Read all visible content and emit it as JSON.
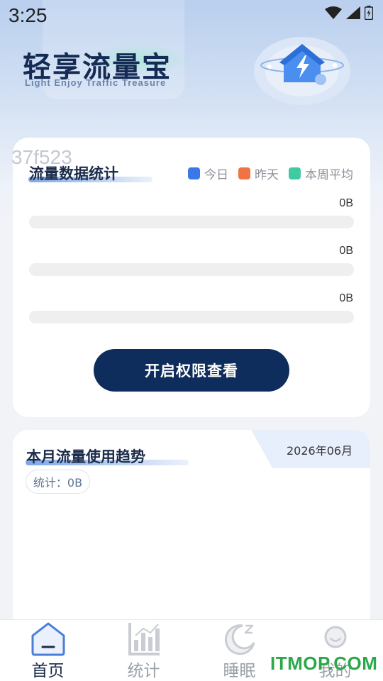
{
  "status_bar": {
    "time": "3:25"
  },
  "header": {
    "app_title_part1": "轻享",
    "app_title_part2": "流量宝",
    "app_subtitle": "Light Enjoy Traffic Treasure"
  },
  "watermark_code": "37f523",
  "stats_card": {
    "title": "流量数据统计",
    "legend": [
      {
        "label": "今日",
        "color": "#3b78e7"
      },
      {
        "label": "昨天",
        "color": "#f07343"
      },
      {
        "label": "本周平均",
        "color": "#3fcaa4"
      }
    ],
    "bars": [
      {
        "value_label": "0B",
        "value": 0,
        "color": "#3b78e7"
      },
      {
        "value_label": "0B",
        "value": 0,
        "color": "#f07343"
      },
      {
        "value_label": "0B",
        "value": 0,
        "color": "#3fcaa4"
      }
    ],
    "button_label": "开启权限查看"
  },
  "trend_card": {
    "title": "本月流量使用趋势",
    "date": "2026年06月",
    "stat_label": "统计：0B"
  },
  "bottom_nav": [
    {
      "label": "首页",
      "icon": "home-icon",
      "active": true
    },
    {
      "label": "统计",
      "icon": "bar-chart-icon",
      "active": false
    },
    {
      "label": "睡眠",
      "icon": "moon-sleep-icon",
      "active": false
    },
    {
      "label": "我的",
      "icon": "profile-icon",
      "active": false
    }
  ],
  "site_watermark": "ITMOP.COM",
  "colors": {
    "primary": "#0f2d5c",
    "accent_blue": "#3b78e7",
    "accent_orange": "#f07343",
    "accent_green": "#3fcaa4"
  }
}
